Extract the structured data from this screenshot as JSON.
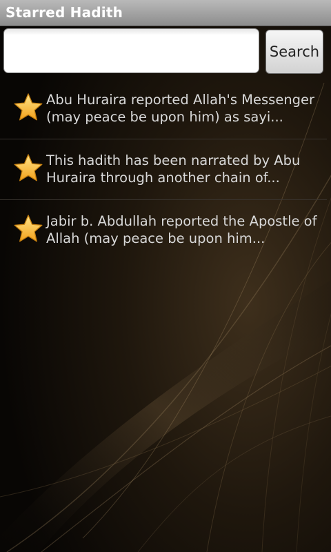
{
  "app": {
    "title": "Starred Hadith"
  },
  "search": {
    "value": "",
    "placeholder": "",
    "button_label": "Search"
  },
  "list": {
    "items": [
      {
        "text": "Abu Huraira reported Allah's Messenger (may peace be upon him) as sayi...",
        "icon": "star-icon"
      },
      {
        "text": "This hadith has been narrated by Abu Huraira through another chain of...",
        "icon": "star-icon"
      },
      {
        "text": "Jabir b. Abdullah reported the Apostle of Allah (may peace be upon him...",
        "icon": "star-icon"
      }
    ]
  },
  "colors": {
    "background": "#0a0806",
    "title_bar": "#a3a3a3",
    "text": "#d8d8d8",
    "star": "#f7b631"
  }
}
